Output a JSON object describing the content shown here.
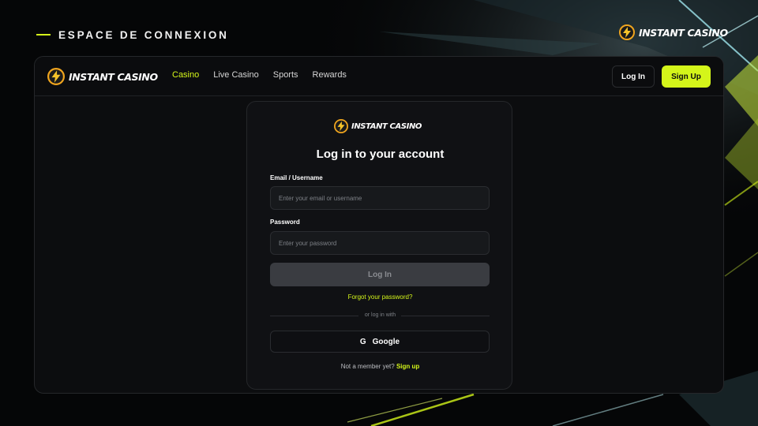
{
  "page_header": {
    "title": "ESPACE DE CONNEXION"
  },
  "brand": {
    "name": "INSTANT CASINO",
    "accent_color": "#d4f51a",
    "logo_icon": "lightning-coin-icon"
  },
  "navbar": {
    "links": [
      {
        "label": "Casino",
        "active": true
      },
      {
        "label": "Live Casino",
        "active": false
      },
      {
        "label": "Sports",
        "active": false
      },
      {
        "label": "Rewards",
        "active": false
      }
    ],
    "login_label": "Log In",
    "signup_label": "Sign Up"
  },
  "login_form": {
    "title": "Log in to your account",
    "email": {
      "label": "Email / Username",
      "placeholder": "Enter your email or username",
      "value": ""
    },
    "password": {
      "label": "Password",
      "placeholder": "Enter your password",
      "value": ""
    },
    "submit_label": "Log In",
    "forgot_label": "Forgot your password?",
    "divider_label": "or log in with",
    "google_icon": "G",
    "google_label": "Google",
    "signup_prompt": "Not a member yet?",
    "signup_link": "Sign up"
  }
}
